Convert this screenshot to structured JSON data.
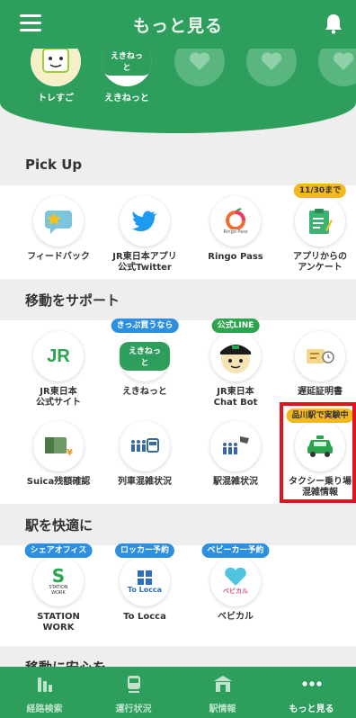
{
  "header": {
    "title": "もっと見る"
  },
  "favorites": [
    {
      "label": "トレすご"
    },
    {
      "label": "えきねっと"
    }
  ],
  "pickup": {
    "title": "Pick Up",
    "items": [
      {
        "label": "フィードバック",
        "badge": ""
      },
      {
        "label": "JR東日本アプリ\n公式Twitter",
        "badge": ""
      },
      {
        "label": "Ringo Pass",
        "badge": ""
      },
      {
        "label": "アプリからの\nアンケート",
        "badge": "11/30まで"
      }
    ]
  },
  "support": {
    "title": "移動をサポート",
    "items": [
      {
        "label": "JR東日本\n公式サイト",
        "badge": ""
      },
      {
        "label": "えきねっと",
        "badge": "きっぷ買うなら"
      },
      {
        "label": "JR東日本\nChat Bot",
        "badge": "公式LINE"
      },
      {
        "label": "遅延証明書",
        "badge": ""
      },
      {
        "label": "Suica残額確認",
        "badge": ""
      },
      {
        "label": "列車混雑状況",
        "badge": ""
      },
      {
        "label": "駅混雑状況",
        "badge": ""
      },
      {
        "label": "タクシー乗り場\n混雑情報",
        "badge": "品川駅で実験中"
      }
    ]
  },
  "comfort": {
    "title": "駅を快適に",
    "items": [
      {
        "label": "STATION\nWORK",
        "badge": "シェアオフィス"
      },
      {
        "label": "To Locca",
        "badge": "ロッカー予約"
      },
      {
        "label": "ベビカル",
        "badge": "ベビーカー予約"
      }
    ]
  },
  "safety": {
    "title": "移動に安心を"
  },
  "logos": {
    "ekinet": "えきねっと",
    "jr": "JR",
    "ringo": "Ringo Pass",
    "station_work": "STATION\nWORK",
    "tolocca": "To Locca",
    "bebikaru": "ベビカル"
  },
  "bottom_nav": [
    {
      "label": "経路検索",
      "icon": "route-icon",
      "active": false
    },
    {
      "label": "運行状況",
      "icon": "train-icon",
      "active": false
    },
    {
      "label": "駅情報",
      "icon": "station-icon",
      "active": false
    },
    {
      "label": "もっと見る",
      "icon": "more-icon",
      "active": true
    }
  ],
  "colors": {
    "primary": "#2d9e5b",
    "badge_blue": "#2d8fe0",
    "badge_yellow": "#f2b81c",
    "highlight": "#e0141e"
  }
}
